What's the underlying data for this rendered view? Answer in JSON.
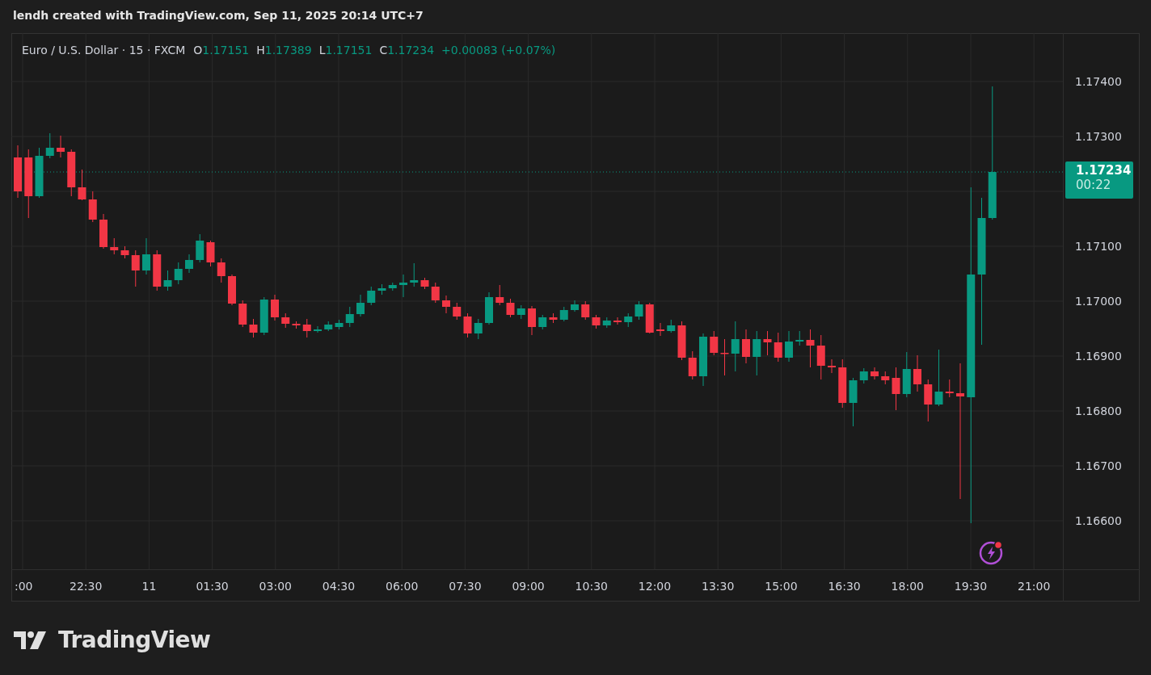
{
  "header": {
    "title": "lendh created with TradingView.com, Sep 11, 2025 20:14 UTC+7"
  },
  "legend": {
    "symbol": "Euro / U.S. Dollar · 15 · FXCM",
    "ohlc": [
      {
        "label": "O",
        "value": "1.17151"
      },
      {
        "label": "H",
        "value": "1.17389"
      },
      {
        "label": "L",
        "value": "1.17151"
      },
      {
        "label": "C",
        "value": "1.17234"
      }
    ],
    "change": "+0.00083 (+0.07%)"
  },
  "price_axis": [
    "1.17400",
    "1.17300",
    "1.17100",
    "1.17000",
    "1.16900",
    "1.16800",
    "1.16700",
    "1.16600"
  ],
  "time_axis": [
    ":00",
    "22:30",
    "11",
    "01:30",
    "03:00",
    "04:30",
    "06:00",
    "07:30",
    "09:00",
    "10:30",
    "12:00",
    "13:30",
    "15:00",
    "16:30",
    "18:00",
    "19:30",
    "21:00"
  ],
  "last_price": {
    "price": "1.17234",
    "countdown": "00:22"
  },
  "logo": {
    "text": "TradingView"
  }
}
